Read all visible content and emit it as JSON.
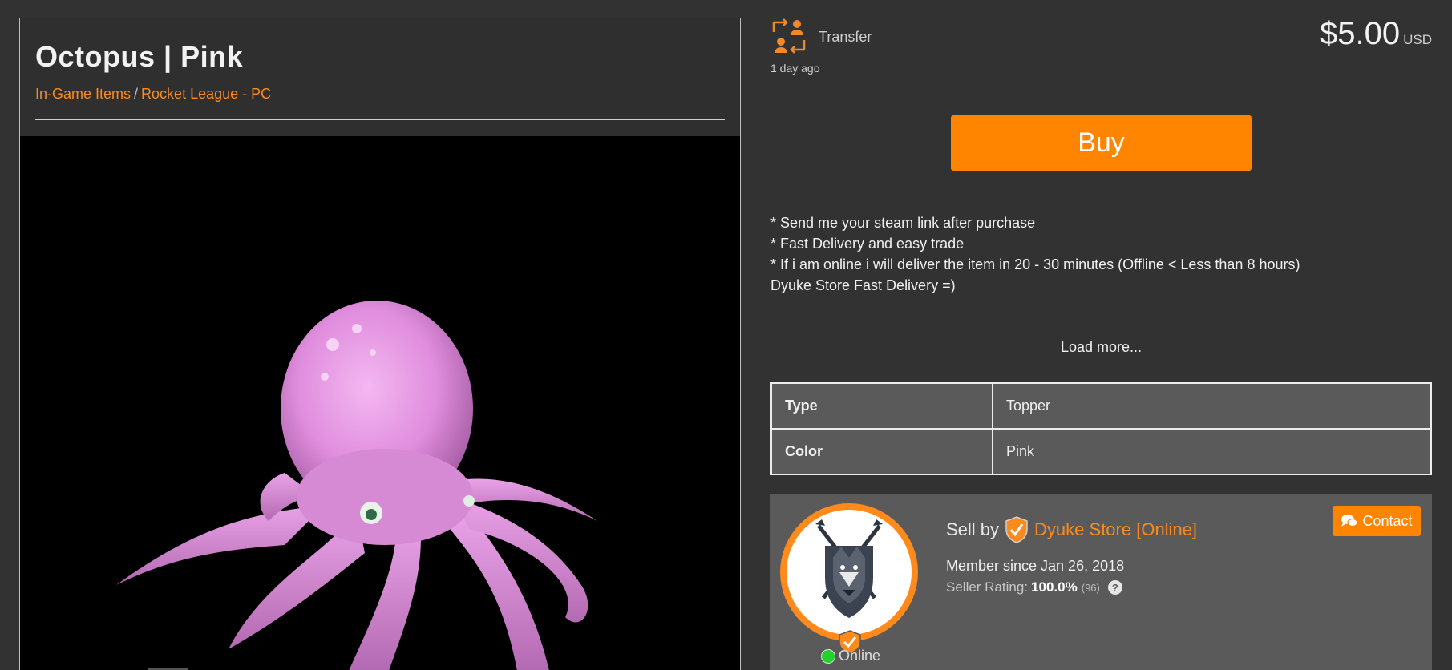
{
  "listing": {
    "title": "Octopus | Pink",
    "breadcrumb": [
      {
        "label": "In-Game Items"
      },
      {
        "label": "Rocket League - PC"
      }
    ],
    "breadcrumb_separator": "/",
    "image_icon": "octopus-image"
  },
  "delivery": {
    "method": "Transfer",
    "icon": "transfer-icon",
    "posted": "1 day ago"
  },
  "price": {
    "amount": "$5.00",
    "currency": "USD"
  },
  "buy_label": "Buy",
  "description": [
    "* Send me your steam link after purchase",
    "* Fast Delivery and easy trade",
    "* If i am online i will deliver the item in 20 - 30 minutes (Offline < Less than 8 hours)",
    "Dyuke Store Fast Delivery =)"
  ],
  "load_more": "Load more...",
  "attributes": [
    {
      "key": "Type",
      "value": "Topper"
    },
    {
      "key": "Color",
      "value": "Pink"
    }
  ],
  "seller": {
    "sell_by_label": "Sell by",
    "name": "Dyuke Store [Online]",
    "member_since": "Member since Jan 26, 2018",
    "rating_label": "Seller Rating:",
    "rating_value": "100.0%",
    "rating_count": "(96)",
    "help": "?",
    "status": "Online",
    "contact_label": "Contact"
  },
  "colors": {
    "accent": "#ff8400",
    "link": "#ff8a1c",
    "online": "#22d12a",
    "octopus": "#e79be6"
  }
}
